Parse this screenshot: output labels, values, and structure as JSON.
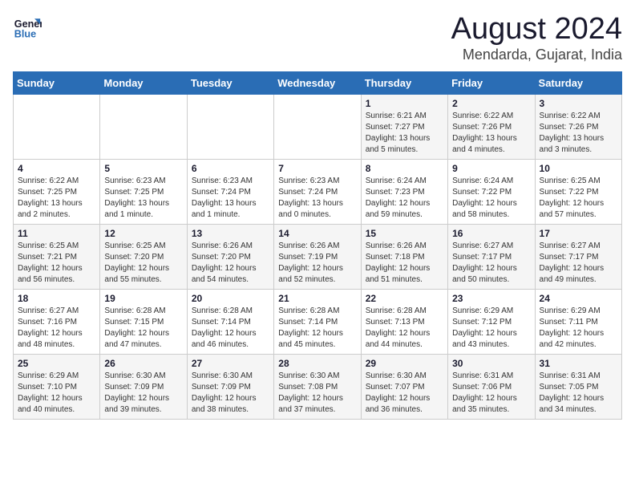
{
  "logo": {
    "line1": "General",
    "line2": "Blue"
  },
  "title": "August 2024",
  "subtitle": "Mendarda, Gujarat, India",
  "weekdays": [
    "Sunday",
    "Monday",
    "Tuesday",
    "Wednesday",
    "Thursday",
    "Friday",
    "Saturday"
  ],
  "weeks": [
    [
      {
        "day": "",
        "info": ""
      },
      {
        "day": "",
        "info": ""
      },
      {
        "day": "",
        "info": ""
      },
      {
        "day": "",
        "info": ""
      },
      {
        "day": "1",
        "info": "Sunrise: 6:21 AM\nSunset: 7:27 PM\nDaylight: 13 hours and 5 minutes."
      },
      {
        "day": "2",
        "info": "Sunrise: 6:22 AM\nSunset: 7:26 PM\nDaylight: 13 hours and 4 minutes."
      },
      {
        "day": "3",
        "info": "Sunrise: 6:22 AM\nSunset: 7:26 PM\nDaylight: 13 hours and 3 minutes."
      }
    ],
    [
      {
        "day": "4",
        "info": "Sunrise: 6:22 AM\nSunset: 7:25 PM\nDaylight: 13 hours and 2 minutes."
      },
      {
        "day": "5",
        "info": "Sunrise: 6:23 AM\nSunset: 7:25 PM\nDaylight: 13 hours and 1 minute."
      },
      {
        "day": "6",
        "info": "Sunrise: 6:23 AM\nSunset: 7:24 PM\nDaylight: 13 hours and 1 minute."
      },
      {
        "day": "7",
        "info": "Sunrise: 6:23 AM\nSunset: 7:24 PM\nDaylight: 13 hours and 0 minutes."
      },
      {
        "day": "8",
        "info": "Sunrise: 6:24 AM\nSunset: 7:23 PM\nDaylight: 12 hours and 59 minutes."
      },
      {
        "day": "9",
        "info": "Sunrise: 6:24 AM\nSunset: 7:22 PM\nDaylight: 12 hours and 58 minutes."
      },
      {
        "day": "10",
        "info": "Sunrise: 6:25 AM\nSunset: 7:22 PM\nDaylight: 12 hours and 57 minutes."
      }
    ],
    [
      {
        "day": "11",
        "info": "Sunrise: 6:25 AM\nSunset: 7:21 PM\nDaylight: 12 hours and 56 minutes."
      },
      {
        "day": "12",
        "info": "Sunrise: 6:25 AM\nSunset: 7:20 PM\nDaylight: 12 hours and 55 minutes."
      },
      {
        "day": "13",
        "info": "Sunrise: 6:26 AM\nSunset: 7:20 PM\nDaylight: 12 hours and 54 minutes."
      },
      {
        "day": "14",
        "info": "Sunrise: 6:26 AM\nSunset: 7:19 PM\nDaylight: 12 hours and 52 minutes."
      },
      {
        "day": "15",
        "info": "Sunrise: 6:26 AM\nSunset: 7:18 PM\nDaylight: 12 hours and 51 minutes."
      },
      {
        "day": "16",
        "info": "Sunrise: 6:27 AM\nSunset: 7:17 PM\nDaylight: 12 hours and 50 minutes."
      },
      {
        "day": "17",
        "info": "Sunrise: 6:27 AM\nSunset: 7:17 PM\nDaylight: 12 hours and 49 minutes."
      }
    ],
    [
      {
        "day": "18",
        "info": "Sunrise: 6:27 AM\nSunset: 7:16 PM\nDaylight: 12 hours and 48 minutes."
      },
      {
        "day": "19",
        "info": "Sunrise: 6:28 AM\nSunset: 7:15 PM\nDaylight: 12 hours and 47 minutes."
      },
      {
        "day": "20",
        "info": "Sunrise: 6:28 AM\nSunset: 7:14 PM\nDaylight: 12 hours and 46 minutes."
      },
      {
        "day": "21",
        "info": "Sunrise: 6:28 AM\nSunset: 7:14 PM\nDaylight: 12 hours and 45 minutes."
      },
      {
        "day": "22",
        "info": "Sunrise: 6:28 AM\nSunset: 7:13 PM\nDaylight: 12 hours and 44 minutes."
      },
      {
        "day": "23",
        "info": "Sunrise: 6:29 AM\nSunset: 7:12 PM\nDaylight: 12 hours and 43 minutes."
      },
      {
        "day": "24",
        "info": "Sunrise: 6:29 AM\nSunset: 7:11 PM\nDaylight: 12 hours and 42 minutes."
      }
    ],
    [
      {
        "day": "25",
        "info": "Sunrise: 6:29 AM\nSunset: 7:10 PM\nDaylight: 12 hours and 40 minutes."
      },
      {
        "day": "26",
        "info": "Sunrise: 6:30 AM\nSunset: 7:09 PM\nDaylight: 12 hours and 39 minutes."
      },
      {
        "day": "27",
        "info": "Sunrise: 6:30 AM\nSunset: 7:09 PM\nDaylight: 12 hours and 38 minutes."
      },
      {
        "day": "28",
        "info": "Sunrise: 6:30 AM\nSunset: 7:08 PM\nDaylight: 12 hours and 37 minutes."
      },
      {
        "day": "29",
        "info": "Sunrise: 6:30 AM\nSunset: 7:07 PM\nDaylight: 12 hours and 36 minutes."
      },
      {
        "day": "30",
        "info": "Sunrise: 6:31 AM\nSunset: 7:06 PM\nDaylight: 12 hours and 35 minutes."
      },
      {
        "day": "31",
        "info": "Sunrise: 6:31 AM\nSunset: 7:05 PM\nDaylight: 12 hours and 34 minutes."
      }
    ]
  ]
}
